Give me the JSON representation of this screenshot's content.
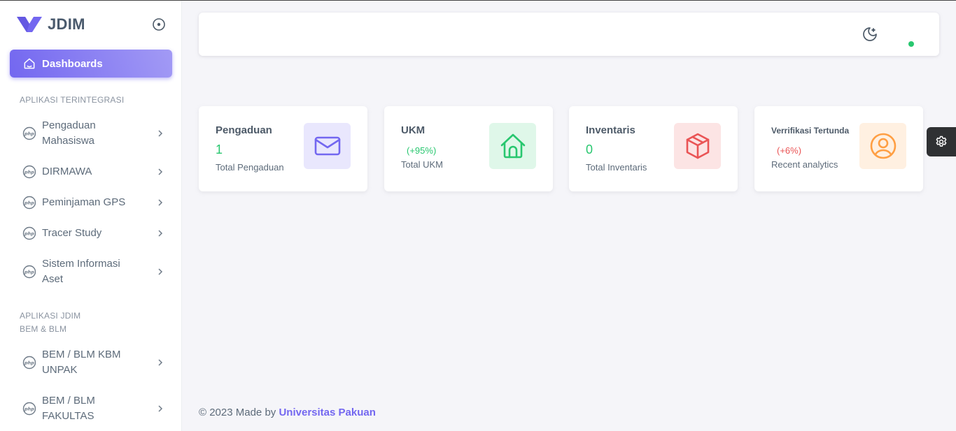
{
  "brand": {
    "name": "JDIM"
  },
  "sidebar": {
    "active": {
      "label": "Dashboards",
      "icon": "home-icon"
    },
    "section1": "APLIKASI TERINTEGRASI",
    "section2_line1": "APLIKASI JDIM",
    "section2_line2": "BEM & BLM",
    "items": [
      {
        "line1": "Pengaduan",
        "line2": "Mahasiswa"
      },
      {
        "line1": "DIRMAWA",
        "line2": ""
      },
      {
        "line1": "Peminjaman GPS",
        "line2": ""
      },
      {
        "line1": "Tracer Study",
        "line2": ""
      },
      {
        "line1": "Sistem Informasi",
        "line2": "Aset"
      },
      {
        "line1": "BEM / BLM KBM",
        "line2": "UNPAK"
      },
      {
        "line1": "BEM / BLM",
        "line2": "FAKULTAS"
      }
    ]
  },
  "cards": [
    {
      "title": "Pengaduan",
      "value": "1",
      "sub": "Total Pengaduan",
      "icon": "mail-icon",
      "color": "#7367f0",
      "bg": "#e9e7fd"
    },
    {
      "title": "UKM",
      "pct": "(+95%)",
      "sub": "Total UKM",
      "icon": "house-icon",
      "color": "#28c76f",
      "bg": "#dff7e9"
    },
    {
      "title": "Inventaris",
      "value": "0",
      "sub": "Total Inventaris",
      "icon": "box-icon",
      "color": "#ea5455",
      "bg": "#fce4e4"
    },
    {
      "title": "Verrifikasi Tertunda",
      "pct": "(+6%)",
      "sub": "Recent analytics",
      "icon": "user-circle-icon",
      "color": "#ff9f43",
      "bg": "#fff0e1"
    }
  ],
  "colors": {
    "primary": "#7367f0",
    "success": "#28c76f",
    "danger": "#ea5455",
    "warning": "#ff9f43"
  },
  "footer": {
    "prefix": "© 2023 Made by ",
    "link": "Universitas Pakuan"
  }
}
